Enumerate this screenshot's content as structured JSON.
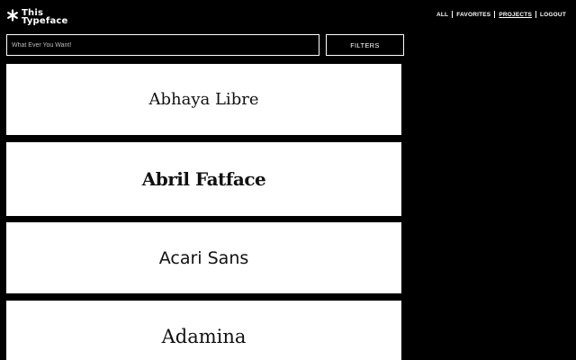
{
  "header": {
    "logo_line1": "This",
    "logo_line2": "Typeface",
    "logo_icon": "asterisk-star-icon"
  },
  "nav": {
    "items": [
      {
        "label": "ALL",
        "active": false
      },
      {
        "label": "FAVORITES",
        "active": false
      },
      {
        "label": "PROJECTS",
        "active": true
      },
      {
        "label": "LOGOUT",
        "active": false
      }
    ]
  },
  "search": {
    "placeholder": "What Ever You Want!",
    "value": ""
  },
  "filters": {
    "label": "FILTERS"
  },
  "fonts": [
    {
      "name": "Abhaya Libre"
    },
    {
      "name": "Abril Fatface"
    },
    {
      "name": "Acari Sans"
    },
    {
      "name": "Adamina"
    }
  ],
  "colors": {
    "background": "#000000",
    "card": "#ffffff",
    "text": "#111111"
  }
}
